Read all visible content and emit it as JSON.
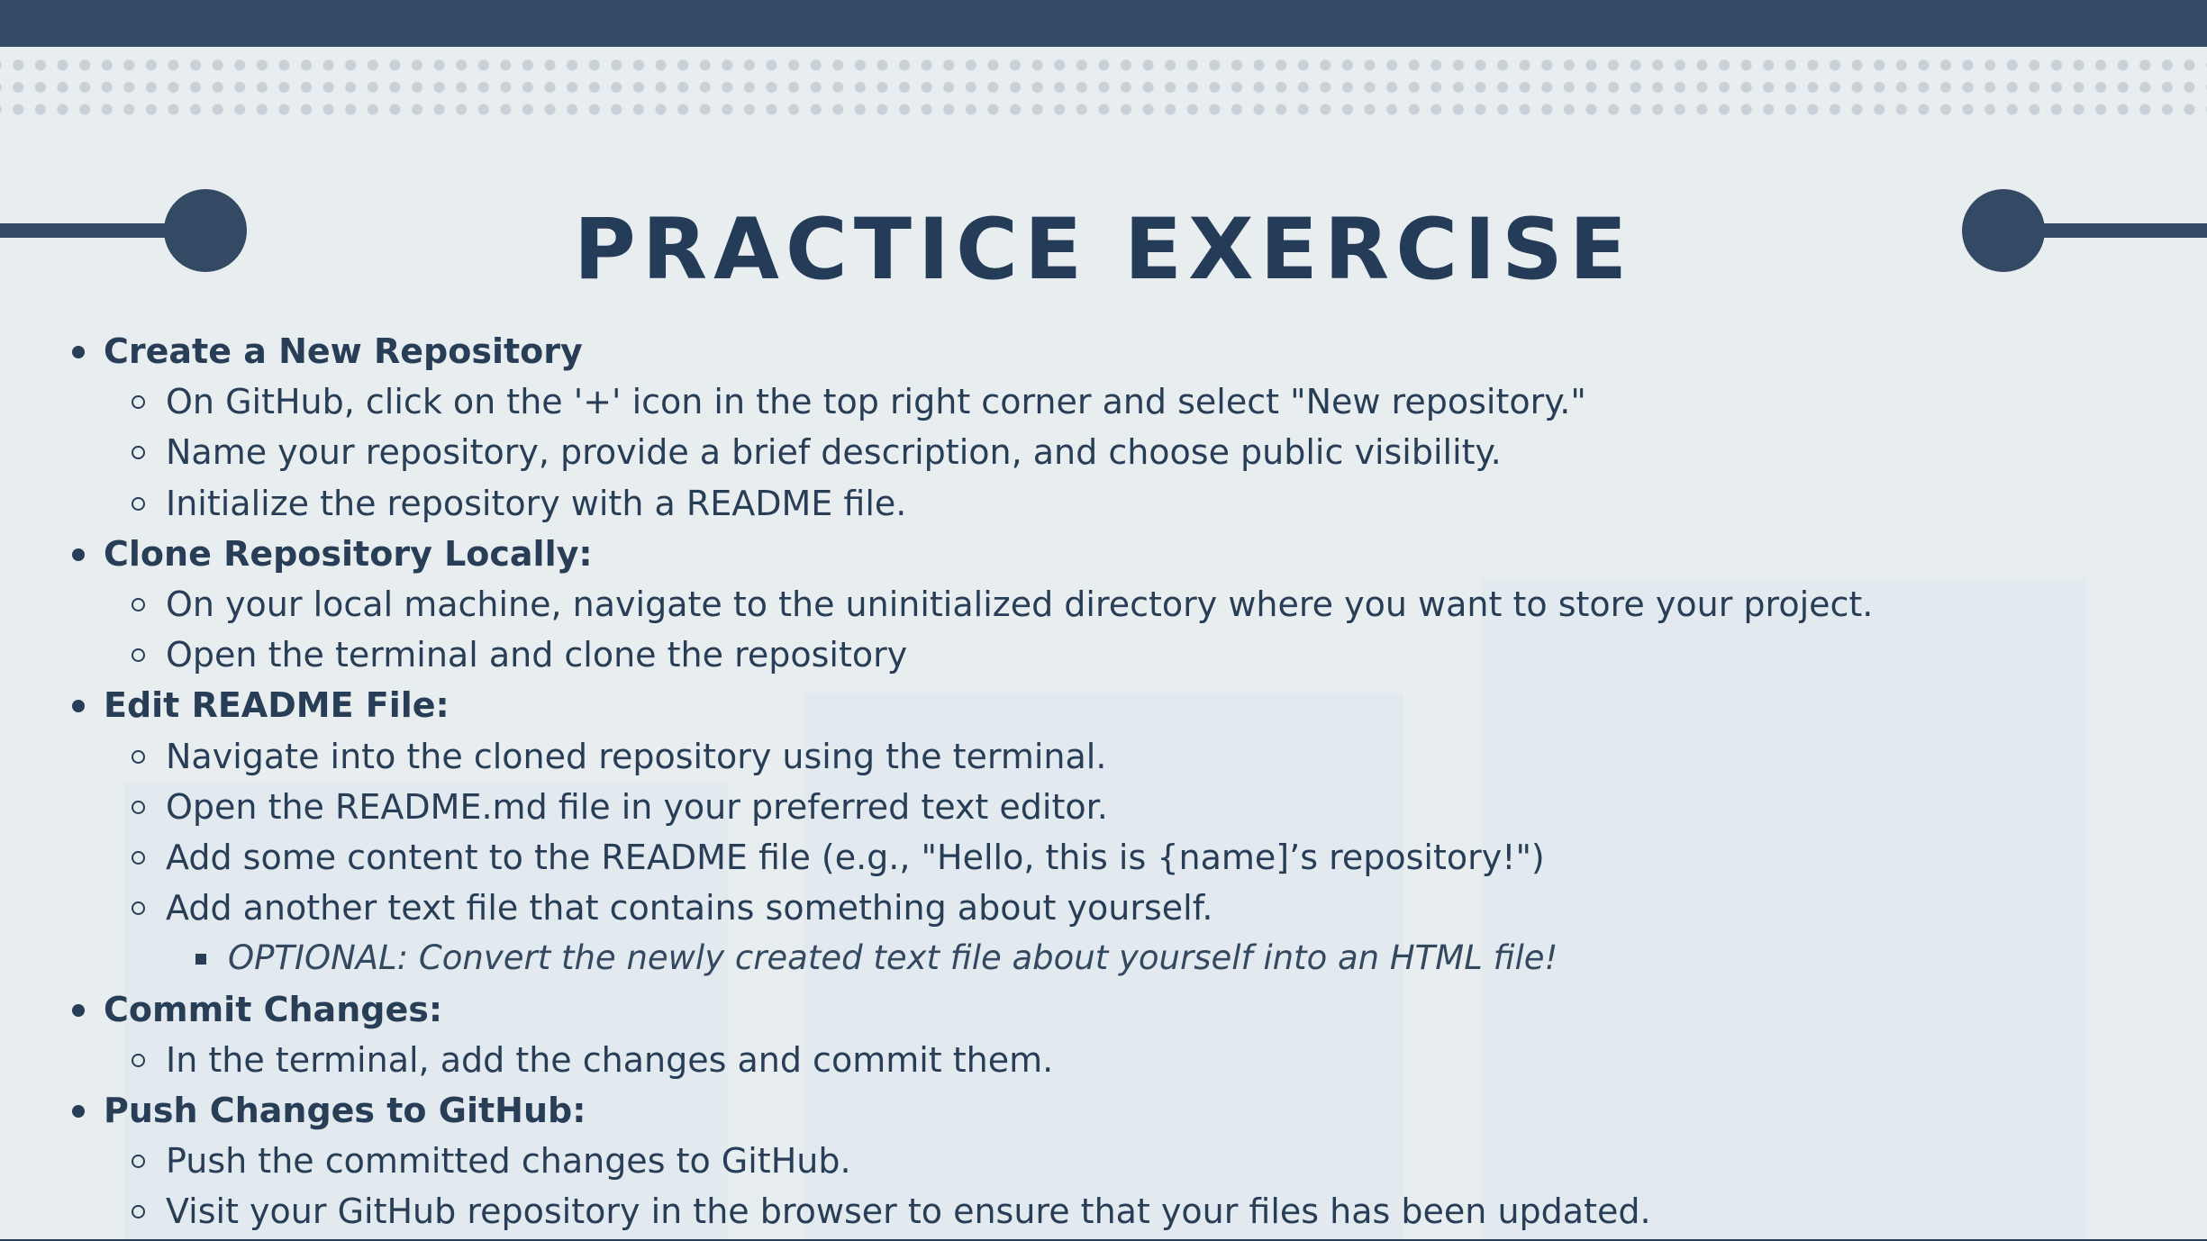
{
  "title": "PRACTICE EXERCISE",
  "sections": [
    {
      "heading": "Create a New Repository",
      "items": [
        "On GitHub, click on the '+' icon in the top right corner and select \"New repository.\"",
        "Name your repository, provide a brief description, and choose public visibility.",
        "Initialize the repository with a README file."
      ]
    },
    {
      "heading": "Clone Repository Locally:",
      "items": [
        "On your local machine, navigate to the uninitialized directory where you want to store your project.",
        "Open the terminal and clone the repository"
      ]
    },
    {
      "heading": "Edit README File:",
      "items": [
        "Navigate into the cloned repository using the terminal.",
        "Open the README.md file in your preferred text editor.",
        "Add some content to the README file (e.g., \"Hello, this is {name]’s repository!\")",
        "Add another text file that contains something about yourself."
      ],
      "sub_items": [
        "OPTIONAL: Convert the newly created text file about yourself into an HTML file!"
      ]
    },
    {
      "heading": "Commit Changes:",
      "items": [
        "In the terminal, add the changes and commit them."
      ]
    },
    {
      "heading": "Push Changes to GitHub:",
      "items": [
        "Push the committed changes to GitHub.",
        "Visit your GitHub repository in the browser to ensure that your files has been updated."
      ]
    }
  ]
}
